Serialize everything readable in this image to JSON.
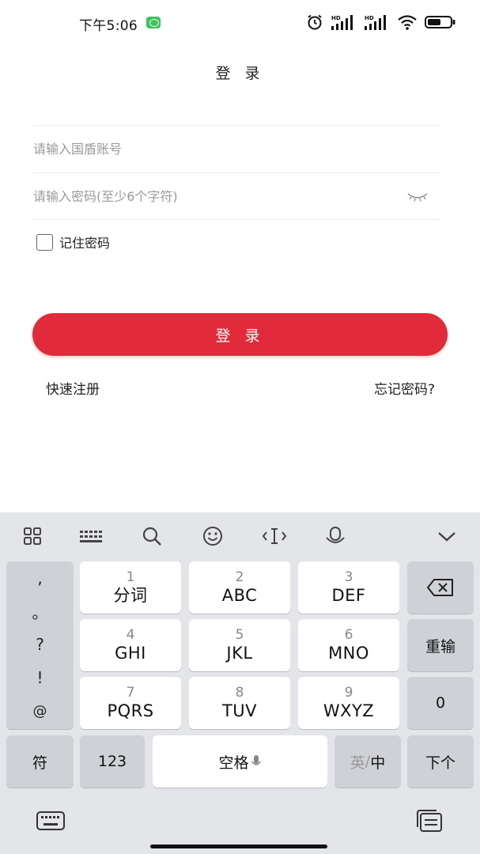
{
  "status_bar": {
    "time": "下午5:06",
    "icons": [
      "wechat-icon",
      "alarm-icon",
      "hd-signal-icon",
      "hd-signal-icon",
      "wifi-icon",
      "battery-icon"
    ]
  },
  "login": {
    "title": "登 录",
    "account_placeholder": "请输入国盾账号",
    "account_value": "",
    "password_placeholder": "请输入密码(至少6个字符)",
    "password_value": "",
    "remember_label": "记住密码",
    "remember_checked": false,
    "login_button": "登 录",
    "register_link": "快速注册",
    "forgot_link": "忘记密码?"
  },
  "keyboard": {
    "toolbar_icons": [
      "apps-icon",
      "keyboard-layout-icon",
      "search-icon",
      "emoji-icon",
      "cursor-icon",
      "voice-icon",
      "collapse-icon"
    ],
    "punctuation": [
      ",",
      "。",
      "?",
      "!",
      "@"
    ],
    "keys": [
      {
        "num": "1",
        "label": "分词"
      },
      {
        "num": "2",
        "label": "ABC"
      },
      {
        "num": "3",
        "label": "DEF"
      },
      {
        "num": "4",
        "label": "GHI"
      },
      {
        "num": "5",
        "label": "JKL"
      },
      {
        "num": "6",
        "label": "MNO"
      },
      {
        "num": "7",
        "label": "PQRS"
      },
      {
        "num": "8",
        "label": "TUV"
      },
      {
        "num": "9",
        "label": "WXYZ"
      }
    ],
    "reinput": "重输",
    "zero": "0",
    "symbols": "符",
    "numbers": "123",
    "space": "空格",
    "lang_en": "英",
    "lang_sep": "/",
    "lang_zh": "中",
    "next": "下个"
  },
  "colors": {
    "accent": "#e22b3a",
    "keyboard_bg": "#e4e5e9",
    "key_dark": "#cfd1d6"
  }
}
